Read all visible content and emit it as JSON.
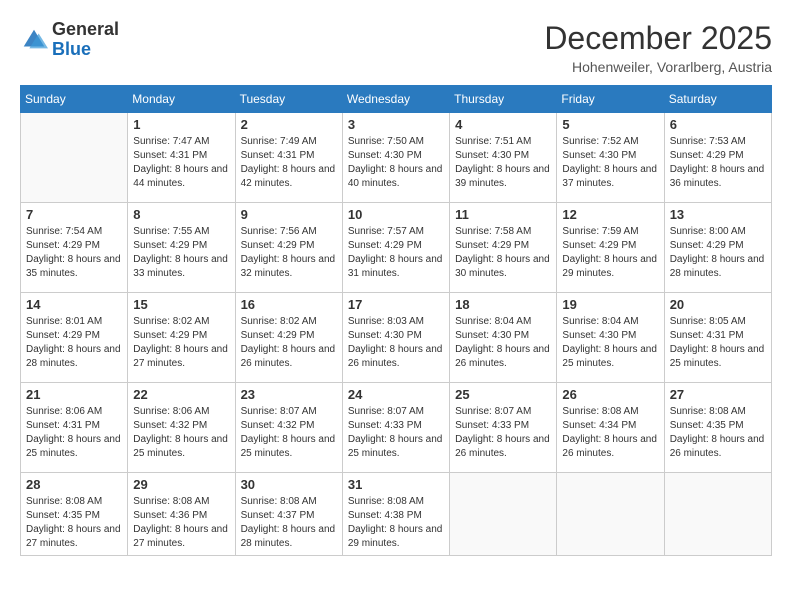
{
  "header": {
    "logo": {
      "general": "General",
      "blue": "Blue"
    },
    "title": "December 2025",
    "location": "Hohenweiler, Vorarlberg, Austria"
  },
  "calendar": {
    "days_of_week": [
      "Sunday",
      "Monday",
      "Tuesday",
      "Wednesday",
      "Thursday",
      "Friday",
      "Saturday"
    ],
    "weeks": [
      [
        {
          "day": "",
          "sunrise": "",
          "sunset": "",
          "daylight": ""
        },
        {
          "day": "1",
          "sunrise": "Sunrise: 7:47 AM",
          "sunset": "Sunset: 4:31 PM",
          "daylight": "Daylight: 8 hours and 44 minutes."
        },
        {
          "day": "2",
          "sunrise": "Sunrise: 7:49 AM",
          "sunset": "Sunset: 4:31 PM",
          "daylight": "Daylight: 8 hours and 42 minutes."
        },
        {
          "day": "3",
          "sunrise": "Sunrise: 7:50 AM",
          "sunset": "Sunset: 4:30 PM",
          "daylight": "Daylight: 8 hours and 40 minutes."
        },
        {
          "day": "4",
          "sunrise": "Sunrise: 7:51 AM",
          "sunset": "Sunset: 4:30 PM",
          "daylight": "Daylight: 8 hours and 39 minutes."
        },
        {
          "day": "5",
          "sunrise": "Sunrise: 7:52 AM",
          "sunset": "Sunset: 4:30 PM",
          "daylight": "Daylight: 8 hours and 37 minutes."
        },
        {
          "day": "6",
          "sunrise": "Sunrise: 7:53 AM",
          "sunset": "Sunset: 4:29 PM",
          "daylight": "Daylight: 8 hours and 36 minutes."
        }
      ],
      [
        {
          "day": "7",
          "sunrise": "Sunrise: 7:54 AM",
          "sunset": "Sunset: 4:29 PM",
          "daylight": "Daylight: 8 hours and 35 minutes."
        },
        {
          "day": "8",
          "sunrise": "Sunrise: 7:55 AM",
          "sunset": "Sunset: 4:29 PM",
          "daylight": "Daylight: 8 hours and 33 minutes."
        },
        {
          "day": "9",
          "sunrise": "Sunrise: 7:56 AM",
          "sunset": "Sunset: 4:29 PM",
          "daylight": "Daylight: 8 hours and 32 minutes."
        },
        {
          "day": "10",
          "sunrise": "Sunrise: 7:57 AM",
          "sunset": "Sunset: 4:29 PM",
          "daylight": "Daylight: 8 hours and 31 minutes."
        },
        {
          "day": "11",
          "sunrise": "Sunrise: 7:58 AM",
          "sunset": "Sunset: 4:29 PM",
          "daylight": "Daylight: 8 hours and 30 minutes."
        },
        {
          "day": "12",
          "sunrise": "Sunrise: 7:59 AM",
          "sunset": "Sunset: 4:29 PM",
          "daylight": "Daylight: 8 hours and 29 minutes."
        },
        {
          "day": "13",
          "sunrise": "Sunrise: 8:00 AM",
          "sunset": "Sunset: 4:29 PM",
          "daylight": "Daylight: 8 hours and 28 minutes."
        }
      ],
      [
        {
          "day": "14",
          "sunrise": "Sunrise: 8:01 AM",
          "sunset": "Sunset: 4:29 PM",
          "daylight": "Daylight: 8 hours and 28 minutes."
        },
        {
          "day": "15",
          "sunrise": "Sunrise: 8:02 AM",
          "sunset": "Sunset: 4:29 PM",
          "daylight": "Daylight: 8 hours and 27 minutes."
        },
        {
          "day": "16",
          "sunrise": "Sunrise: 8:02 AM",
          "sunset": "Sunset: 4:29 PM",
          "daylight": "Daylight: 8 hours and 26 minutes."
        },
        {
          "day": "17",
          "sunrise": "Sunrise: 8:03 AM",
          "sunset": "Sunset: 4:30 PM",
          "daylight": "Daylight: 8 hours and 26 minutes."
        },
        {
          "day": "18",
          "sunrise": "Sunrise: 8:04 AM",
          "sunset": "Sunset: 4:30 PM",
          "daylight": "Daylight: 8 hours and 26 minutes."
        },
        {
          "day": "19",
          "sunrise": "Sunrise: 8:04 AM",
          "sunset": "Sunset: 4:30 PM",
          "daylight": "Daylight: 8 hours and 25 minutes."
        },
        {
          "day": "20",
          "sunrise": "Sunrise: 8:05 AM",
          "sunset": "Sunset: 4:31 PM",
          "daylight": "Daylight: 8 hours and 25 minutes."
        }
      ],
      [
        {
          "day": "21",
          "sunrise": "Sunrise: 8:06 AM",
          "sunset": "Sunset: 4:31 PM",
          "daylight": "Daylight: 8 hours and 25 minutes."
        },
        {
          "day": "22",
          "sunrise": "Sunrise: 8:06 AM",
          "sunset": "Sunset: 4:32 PM",
          "daylight": "Daylight: 8 hours and 25 minutes."
        },
        {
          "day": "23",
          "sunrise": "Sunrise: 8:07 AM",
          "sunset": "Sunset: 4:32 PM",
          "daylight": "Daylight: 8 hours and 25 minutes."
        },
        {
          "day": "24",
          "sunrise": "Sunrise: 8:07 AM",
          "sunset": "Sunset: 4:33 PM",
          "daylight": "Daylight: 8 hours and 25 minutes."
        },
        {
          "day": "25",
          "sunrise": "Sunrise: 8:07 AM",
          "sunset": "Sunset: 4:33 PM",
          "daylight": "Daylight: 8 hours and 26 minutes."
        },
        {
          "day": "26",
          "sunrise": "Sunrise: 8:08 AM",
          "sunset": "Sunset: 4:34 PM",
          "daylight": "Daylight: 8 hours and 26 minutes."
        },
        {
          "day": "27",
          "sunrise": "Sunrise: 8:08 AM",
          "sunset": "Sunset: 4:35 PM",
          "daylight": "Daylight: 8 hours and 26 minutes."
        }
      ],
      [
        {
          "day": "28",
          "sunrise": "Sunrise: 8:08 AM",
          "sunset": "Sunset: 4:35 PM",
          "daylight": "Daylight: 8 hours and 27 minutes."
        },
        {
          "day": "29",
          "sunrise": "Sunrise: 8:08 AM",
          "sunset": "Sunset: 4:36 PM",
          "daylight": "Daylight: 8 hours and 27 minutes."
        },
        {
          "day": "30",
          "sunrise": "Sunrise: 8:08 AM",
          "sunset": "Sunset: 4:37 PM",
          "daylight": "Daylight: 8 hours and 28 minutes."
        },
        {
          "day": "31",
          "sunrise": "Sunrise: 8:08 AM",
          "sunset": "Sunset: 4:38 PM",
          "daylight": "Daylight: 8 hours and 29 minutes."
        },
        {
          "day": "",
          "sunrise": "",
          "sunset": "",
          "daylight": ""
        },
        {
          "day": "",
          "sunrise": "",
          "sunset": "",
          "daylight": ""
        },
        {
          "day": "",
          "sunrise": "",
          "sunset": "",
          "daylight": ""
        }
      ]
    ]
  }
}
